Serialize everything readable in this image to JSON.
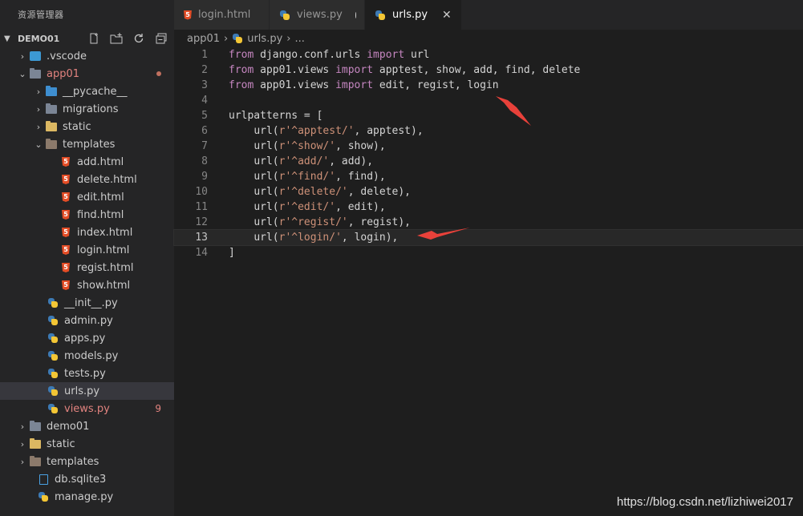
{
  "sidebar": {
    "title": "资源管理器",
    "section": "DEMO01",
    "tree": [
      {
        "label": ".vscode",
        "icon": "vscode-folder-icon",
        "arrow": "›"
      },
      {
        "label": "app01",
        "icon": "folder-icon",
        "arrow": "⌄",
        "modified": true,
        "dot": true
      },
      {
        "label": "__pycache__",
        "icon": "pycache-folder-icon",
        "arrow": "›"
      },
      {
        "label": "migrations",
        "icon": "folder-icon",
        "arrow": "›"
      },
      {
        "label": "static",
        "icon": "static-folder-icon",
        "arrow": "›"
      },
      {
        "label": "templates",
        "icon": "templates-folder-icon",
        "arrow": "⌄"
      },
      {
        "label": "add.html",
        "icon": "html5-icon"
      },
      {
        "label": "delete.html",
        "icon": "html5-icon"
      },
      {
        "label": "edit.html",
        "icon": "html5-icon"
      },
      {
        "label": "find.html",
        "icon": "html5-icon"
      },
      {
        "label": "index.html",
        "icon": "html5-icon"
      },
      {
        "label": "login.html",
        "icon": "html5-icon"
      },
      {
        "label": "regist.html",
        "icon": "html5-icon"
      },
      {
        "label": "show.html",
        "icon": "html5-icon"
      },
      {
        "label": "__init__.py",
        "icon": "python-icon"
      },
      {
        "label": "admin.py",
        "icon": "python-icon"
      },
      {
        "label": "apps.py",
        "icon": "python-icon"
      },
      {
        "label": "models.py",
        "icon": "python-icon"
      },
      {
        "label": "tests.py",
        "icon": "python-icon"
      },
      {
        "label": "urls.py",
        "icon": "python-icon",
        "selected": true
      },
      {
        "label": "views.py",
        "icon": "python-icon",
        "modified": true,
        "badge": "9"
      },
      {
        "label": "demo01",
        "icon": "folder-icon",
        "arrow": "›"
      },
      {
        "label": "static",
        "icon": "static-folder-icon",
        "arrow": "›"
      },
      {
        "label": "templates",
        "icon": "templates-folder-icon",
        "arrow": "›"
      },
      {
        "label": "db.sqlite3",
        "icon": "database-icon"
      },
      {
        "label": "manage.py",
        "icon": "python-icon"
      }
    ]
  },
  "tabs": [
    {
      "label": "login.html",
      "icon": "html5-icon"
    },
    {
      "label": "views.py",
      "icon": "python-icon",
      "dirty": true
    },
    {
      "label": "urls.py",
      "icon": "python-icon",
      "active": true
    }
  ],
  "breadcrumb": {
    "folder": "app01",
    "file": "urls.py",
    "more": "..."
  },
  "code": {
    "current_line": 13,
    "lines": [
      "from django.conf.urls import url",
      "from app01.views import apptest, show, add, find, delete",
      "from app01.views import edit, regist, login",
      "",
      "urlpatterns = [",
      "    url(r'^apptest/', apptest),",
      "    url(r'^show/', show),",
      "    url(r'^add/', add),",
      "    url(r'^find/', find),",
      "    url(r'^delete/', delete),",
      "    url(r'^edit/', edit),",
      "    url(r'^regist/', regist),",
      "    url(r'^login/', login),",
      "]"
    ]
  },
  "watermark": "https://blog.csdn.net/lizhiwei2017",
  "colors": {
    "annotation_arrow": "#e8413a",
    "keyword": "#c586c0",
    "string": "#ce9178"
  }
}
